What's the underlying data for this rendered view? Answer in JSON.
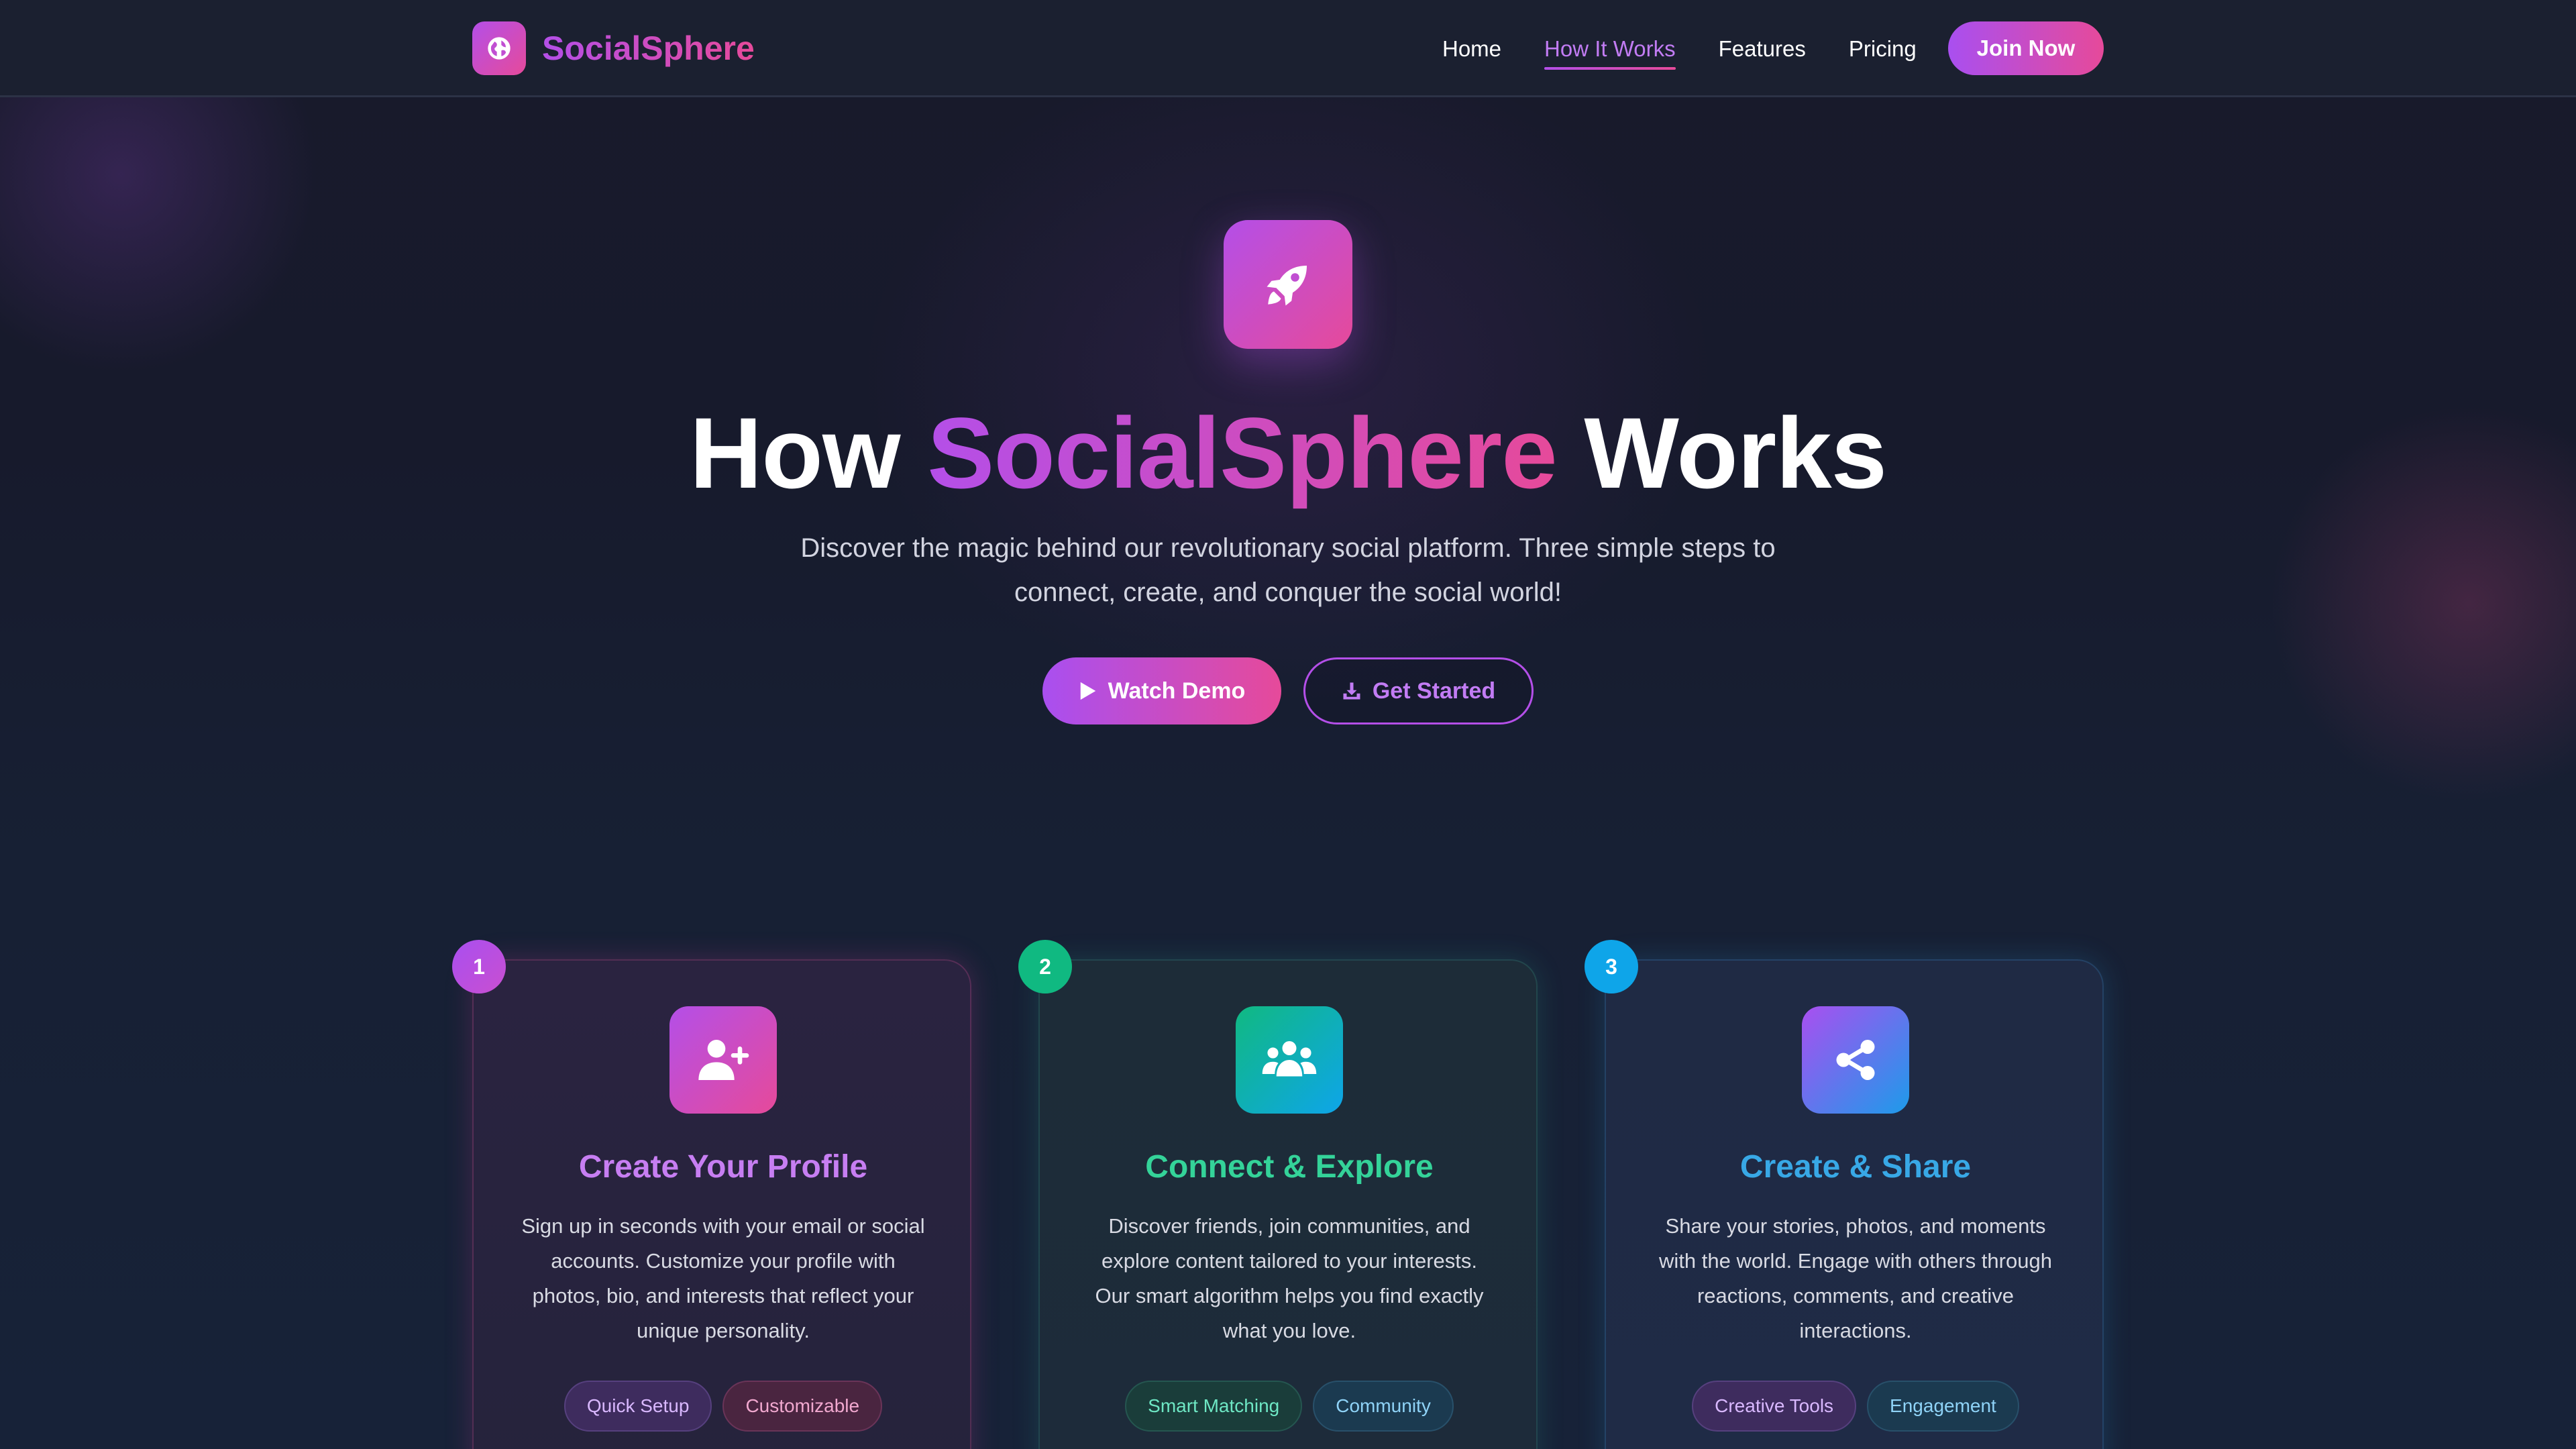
{
  "colors": {
    "accent_purple": "#b44fe8",
    "accent_pink": "#e64a9a",
    "green": "#10b981",
    "blue": "#0ea5e9",
    "background": "#161a2b"
  },
  "nav": {
    "brand": "SocialSphere",
    "brand_icon": "globe-icon",
    "links": [
      {
        "label": "Home",
        "active": false
      },
      {
        "label": "How It Works",
        "active": true
      },
      {
        "label": "Features",
        "active": false
      },
      {
        "label": "Pricing",
        "active": false
      }
    ],
    "cta": "Join Now"
  },
  "hero": {
    "icon": "rocket-icon",
    "title_prefix": "How",
    "title_highlight": "SocialSphere",
    "title_suffix": "Works",
    "subtitle": "Discover the magic behind our revolutionary social platform. Three simple steps to connect, create, and conquer the social world!",
    "primary_button": "Watch Demo",
    "secondary_button": "Get Started"
  },
  "steps": [
    {
      "number": "1",
      "icon": "user-plus-icon",
      "title": "Create Your Profile",
      "description": "Sign up in seconds with your email or social accounts. Customize your profile with photos, bio, and interests that reflect your unique personality.",
      "tags": [
        "Quick Setup",
        "Customizable"
      ]
    },
    {
      "number": "2",
      "icon": "users-icon",
      "title": "Connect & Explore",
      "description": "Discover friends, join communities, and explore content tailored to your interests. Our smart algorithm helps you find exactly what you love.",
      "tags": [
        "Smart Matching",
        "Community"
      ]
    },
    {
      "number": "3",
      "icon": "share-icon",
      "title": "Create & Share",
      "description": "Share your stories, photos, and moments with the world. Engage with others through reactions, comments, and creative interactions.",
      "tags": [
        "Creative Tools",
        "Engagement"
      ]
    }
  ]
}
